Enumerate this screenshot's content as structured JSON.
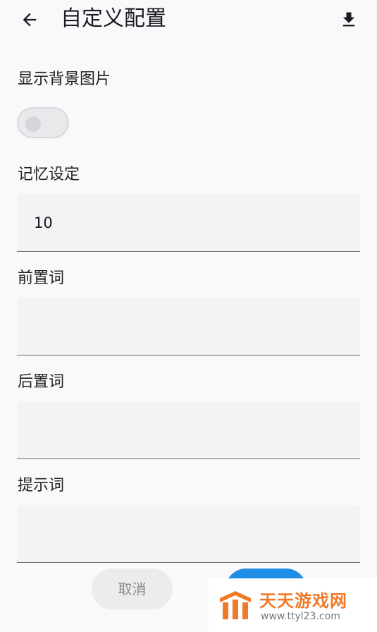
{
  "header": {
    "title": "自定义配置",
    "back_icon": "arrow-left-icon",
    "download_icon": "download-icon"
  },
  "background_image": {
    "label": "显示背景图片",
    "enabled": false
  },
  "memory": {
    "label": "记忆设定",
    "value": "10"
  },
  "prefix": {
    "label": "前置词",
    "value": ""
  },
  "suffix": {
    "label": "后置词",
    "value": ""
  },
  "prompt": {
    "label": "提示词",
    "value": ""
  },
  "actions": {
    "cancel_label": "取消"
  },
  "watermark": {
    "name": "天天游戏网",
    "url": "www.ttyl23.com"
  },
  "colors": {
    "accent": "#1e8ee6",
    "background": "#f9f9fb",
    "field_bg": "#f3f3f5",
    "watermark_orange": "#f07a28"
  }
}
